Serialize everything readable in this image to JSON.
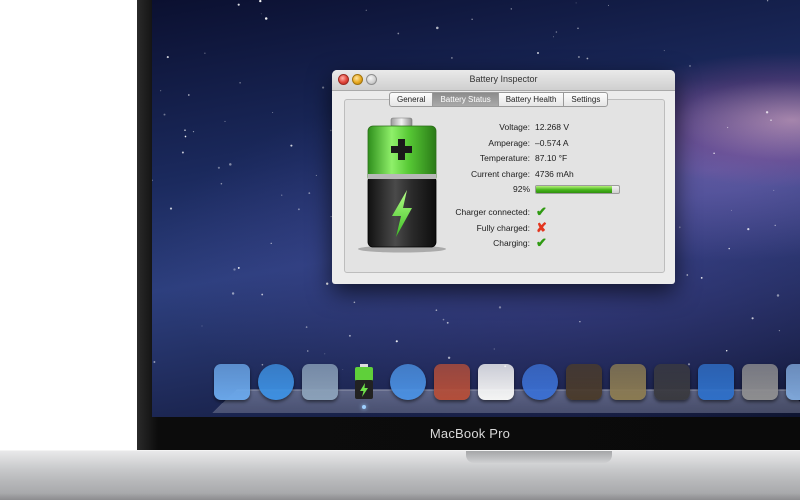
{
  "device": {
    "brand": "MacBook Pro"
  },
  "window": {
    "title": "Battery Inspector",
    "tabs": [
      {
        "label": "General",
        "active": false
      },
      {
        "label": "Battery Status",
        "active": true
      },
      {
        "label": "Battery Health",
        "active": false
      },
      {
        "label": "Settings",
        "active": false
      }
    ]
  },
  "battery": {
    "voltage_label": "Voltage:",
    "voltage_value": "12.268 V",
    "amperage_label": "Amperage:",
    "amperage_value": "–0.574 A",
    "temperature_label": "Temperature:",
    "temperature_value": "87.10 °F",
    "current_charge_label": "Current charge:",
    "current_charge_value": "4736 mAh",
    "percent_text": "92%",
    "percent_value": 92,
    "charger_connected_label": "Charger connected:",
    "charger_connected": true,
    "fully_charged_label": "Fully charged:",
    "fully_charged": false,
    "charging_label": "Charging:",
    "charging": true,
    "check_symbol": "✔",
    "cross_symbol": "✘"
  },
  "dock": {
    "items": [
      {
        "icon": "finder-icon",
        "color": "#6aa6e8"
      },
      {
        "icon": "app-store-icon",
        "color": "#3d8fe0"
      },
      {
        "icon": "mail-icon",
        "color": "#8aa0b8"
      },
      {
        "icon": "battery-inspector-icon",
        "color": "#3a3a3a",
        "running": true
      },
      {
        "icon": "safari-icon",
        "color": "#4a8fe0"
      },
      {
        "icon": "photo-booth-icon",
        "color": "#b24e3a"
      },
      {
        "icon": "calendar-icon",
        "color": "#f4f4f4"
      },
      {
        "icon": "itunes-icon",
        "color": "#3b6fd1"
      },
      {
        "icon": "dvd-player-icon",
        "color": "#4a3b2c"
      },
      {
        "icon": "iphoto-icon",
        "color": "#8a7a52"
      },
      {
        "icon": "imovie-icon",
        "color": "#3a3a40"
      },
      {
        "icon": "xcode-icon",
        "color": "#2f6fc7"
      },
      {
        "icon": "system-preferences-icon",
        "color": "#8d8d8f"
      },
      {
        "icon": "applications-folder-icon",
        "color": "#7ea6d8"
      }
    ]
  }
}
